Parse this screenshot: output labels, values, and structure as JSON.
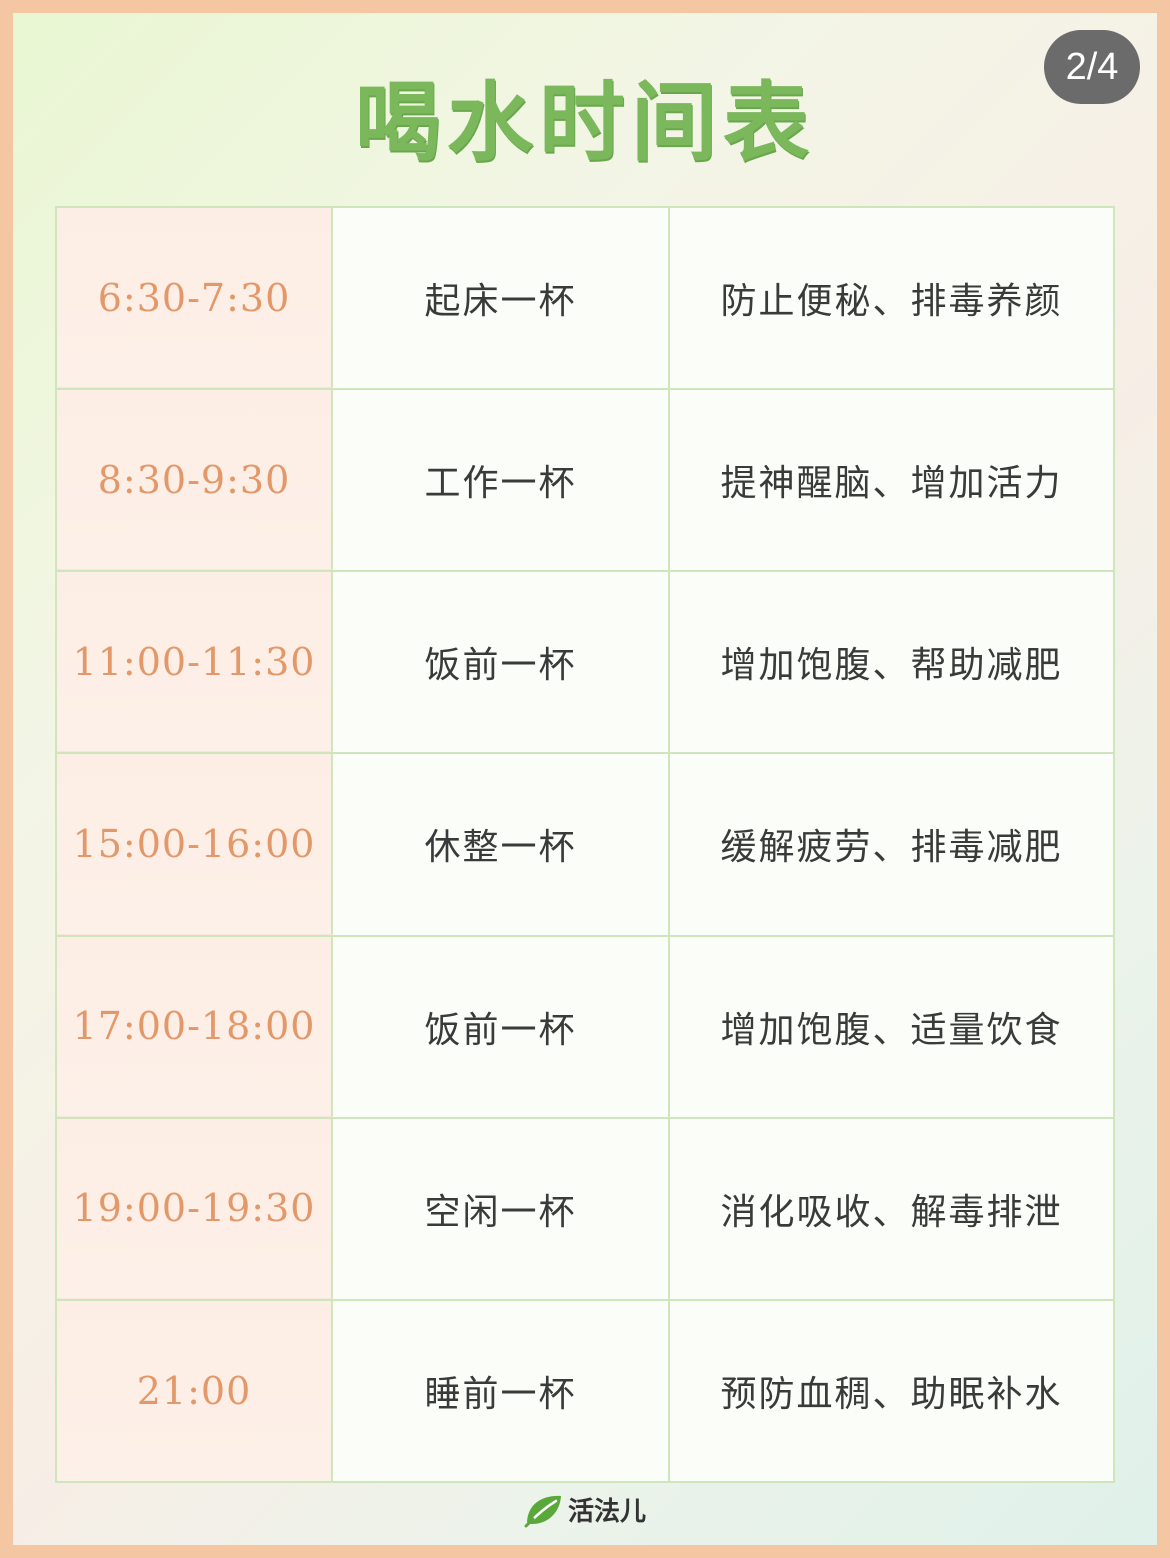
{
  "header": {
    "title": "喝水时间表",
    "page_indicator": "2/4"
  },
  "schedule": [
    {
      "time": "6:30-7:30",
      "name": "起床一杯",
      "benefit": "防止便秘、排毒养颜"
    },
    {
      "time": "8:30-9:30",
      "name": "工作一杯",
      "benefit": "提神醒脑、增加活力"
    },
    {
      "time": "11:00-11:30",
      "name": "饭前一杯",
      "benefit": "增加饱腹、帮助减肥"
    },
    {
      "time": "15:00-16:00",
      "name": "休整一杯",
      "benefit": "缓解疲劳、排毒减肥"
    },
    {
      "time": "17:00-18:00",
      "name": "饭前一杯",
      "benefit": "增加饱腹、适量饮食"
    },
    {
      "time": "19:00-19:30",
      "name": "空闲一杯",
      "benefit": "消化吸收、解毒排泄"
    },
    {
      "time": "21:00",
      "name": "睡前一杯",
      "benefit": "预防血稠、助眠补水"
    }
  ],
  "footer": {
    "brand_icon": "leaf-icon",
    "brand_name": "活法儿"
  },
  "colors": {
    "frame": "#f5c6a2",
    "title": "#7bb85c",
    "time_text": "#e39869",
    "grid_line": "#cfe6bd",
    "brand_leaf": "#5aa83a"
  }
}
